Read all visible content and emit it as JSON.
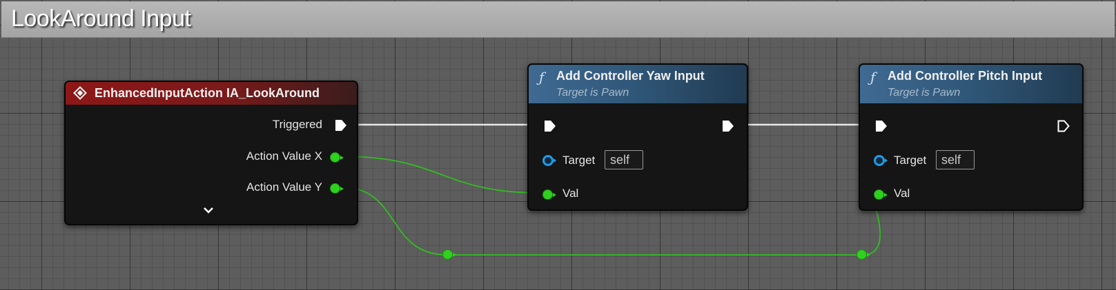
{
  "comment": {
    "title": "LookAround Input"
  },
  "event_node": {
    "title": "EnhancedInputAction IA_LookAround",
    "pins": {
      "triggered": "Triggered",
      "action_value_x": "Action Value X",
      "action_value_y": "Action Value Y"
    }
  },
  "yaw_node": {
    "title": "Add Controller Yaw Input",
    "subtitle": "Target is Pawn",
    "target_label": "Target",
    "target_value": "self",
    "val_label": "Val"
  },
  "pitch_node": {
    "title": "Add Controller Pitch Input",
    "subtitle": "Target is Pawn",
    "target_label": "Target",
    "target_value": "self",
    "val_label": "Val"
  },
  "colors": {
    "event_header": "#8e1717",
    "function_header": "#3f6a92",
    "float_pin": "#2fd01f",
    "object_pin": "#1f9ce8",
    "exec_pin": "#ffffff"
  },
  "icons": {
    "event": "event-diamond-icon",
    "function": "function-f-icon",
    "expand": "chevron-down-icon"
  }
}
